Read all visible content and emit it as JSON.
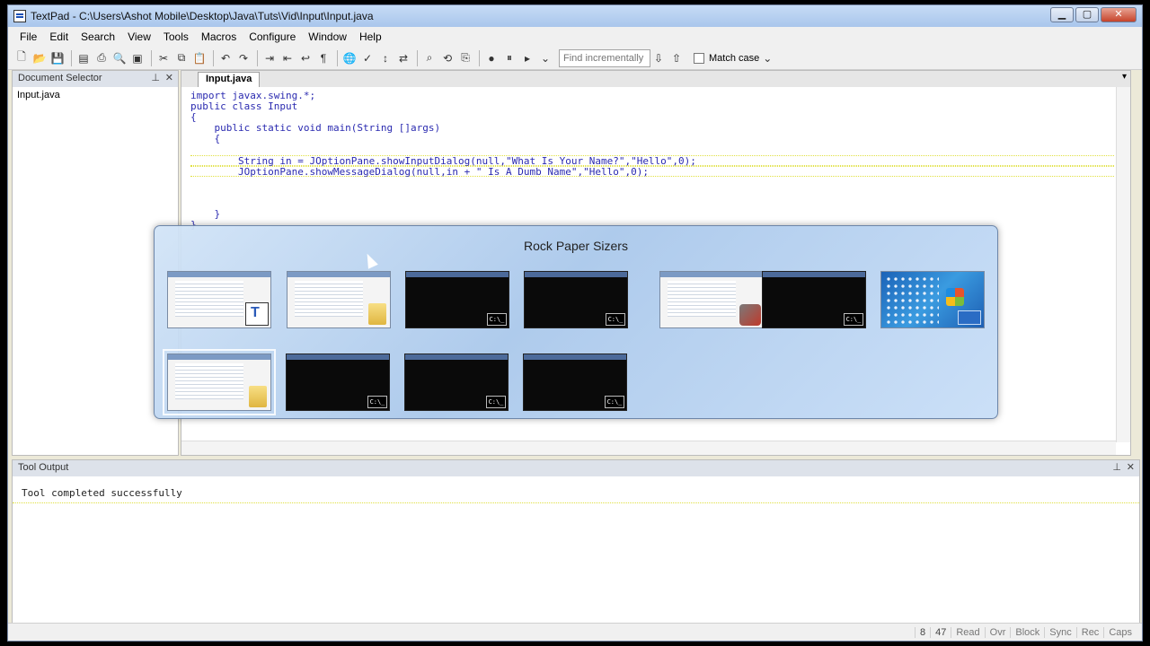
{
  "window": {
    "title": "TextPad - C:\\Users\\Ashot Mobile\\Desktop\\Java\\Tuts\\Vid\\Input\\Input.java"
  },
  "menu": [
    "File",
    "Edit",
    "Search",
    "View",
    "Tools",
    "Macros",
    "Configure",
    "Window",
    "Help"
  ],
  "toolbar": {
    "find_placeholder": "Find incrementally",
    "match_case_label": "Match case"
  },
  "doc_selector": {
    "title": "Document Selector",
    "items": [
      "Input.java"
    ]
  },
  "editor": {
    "tab": "Input.java",
    "lines": [
      "import javax.swing.*;",
      "public class Input",
      "{",
      "    public static void main(String []args)",
      "    {",
      "",
      "        String in = JOptionPane.showInputDialog(null,\"What Is Your Name?\",\"Hello\",0);",
      "        JOptionPane.showMessageDialog(null,in + \" Is A Dumb Name\",\"Hello\",0);",
      "",
      "",
      "",
      "    }",
      "}"
    ]
  },
  "tool_output": {
    "title": "Tool Output",
    "text": "Tool completed successfully"
  },
  "status": {
    "line": "8",
    "col": "47",
    "flags": [
      "Read",
      "Ovr",
      "Block",
      "Sync",
      "Rec",
      "Caps"
    ]
  },
  "switcher": {
    "title": "Rock Paper Sizers",
    "windows": [
      {
        "kind": "textpad"
      },
      {
        "kind": "explorer"
      },
      {
        "kind": "cmd"
      },
      {
        "kind": "cmd"
      },
      {
        "kind": "tool"
      },
      {
        "kind": "cmd"
      },
      {
        "kind": "desktop"
      },
      {
        "kind": "explorer",
        "selected": true
      },
      {
        "kind": "cmd"
      },
      {
        "kind": "cmd"
      },
      {
        "kind": "cmd"
      }
    ],
    "cmd_badge": "C:\\_"
  }
}
